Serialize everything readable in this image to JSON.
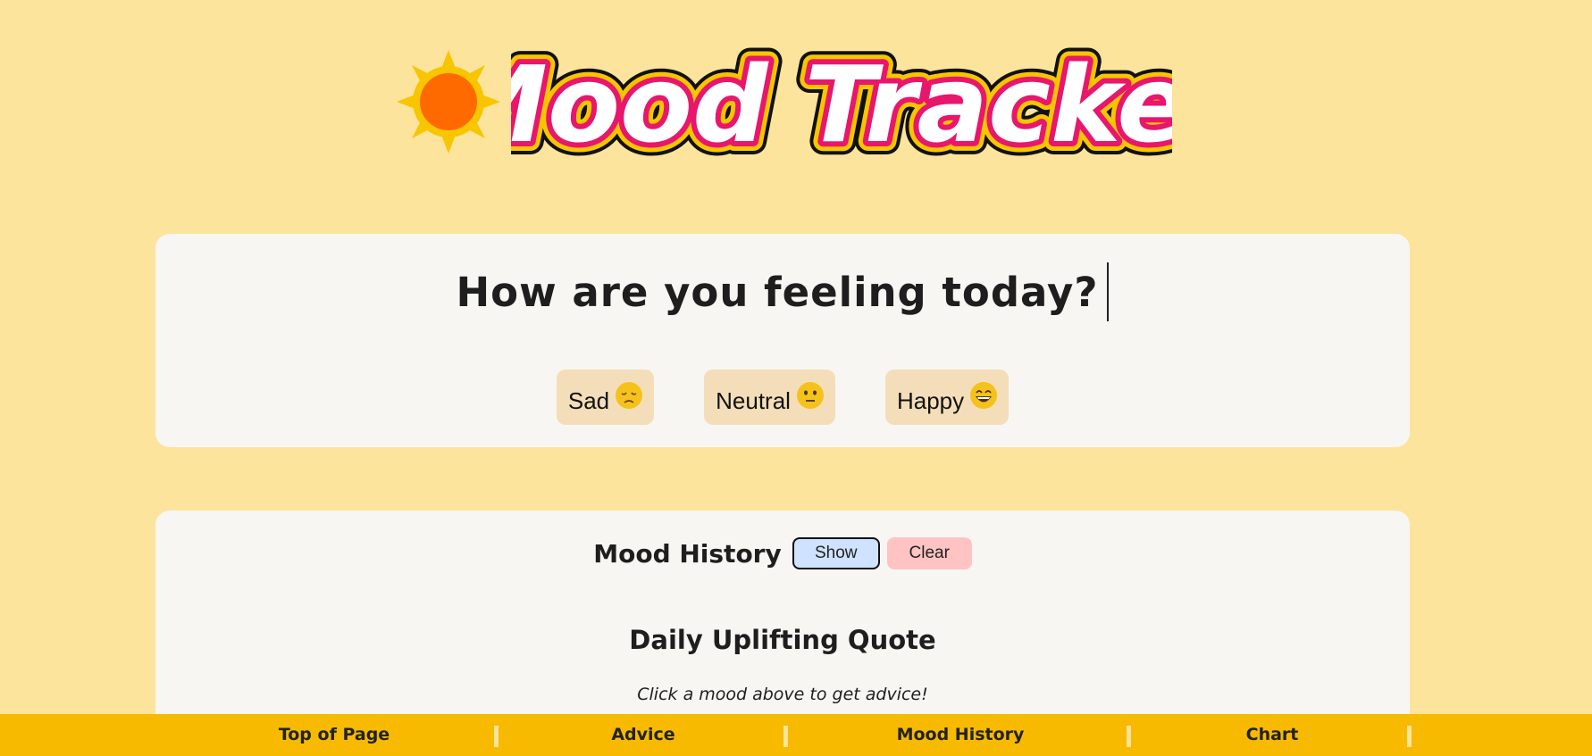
{
  "header": {
    "logo_text": "Mood Tracker",
    "sun_icon": "sun-icon"
  },
  "mood_card": {
    "question": "How are you feeling today?",
    "buttons": [
      {
        "label": "Sad",
        "icon": "sad-face-emoji"
      },
      {
        "label": "Neutral",
        "icon": "neutral-face-emoji"
      },
      {
        "label": "Happy",
        "icon": "happy-face-emoji"
      }
    ]
  },
  "history_card": {
    "title": "Mood History",
    "show_label": "Show",
    "clear_label": "Clear",
    "quote_title": "Daily Uplifting Quote",
    "quote_text": "Click a mood above to get advice!"
  },
  "bottom_nav": {
    "items": [
      "Top of Page",
      "Advice",
      "Mood History",
      "Chart"
    ]
  },
  "colors": {
    "background": "#fde49c",
    "card": "#f8f6f2",
    "nav_bar": "#f7ba00",
    "mood_button": "#f4deb9",
    "show_button": "#cfe2ff",
    "clear_button": "#ffc3c3",
    "logo_pink": "#e8166d",
    "logo_yellow": "#f7c600"
  }
}
